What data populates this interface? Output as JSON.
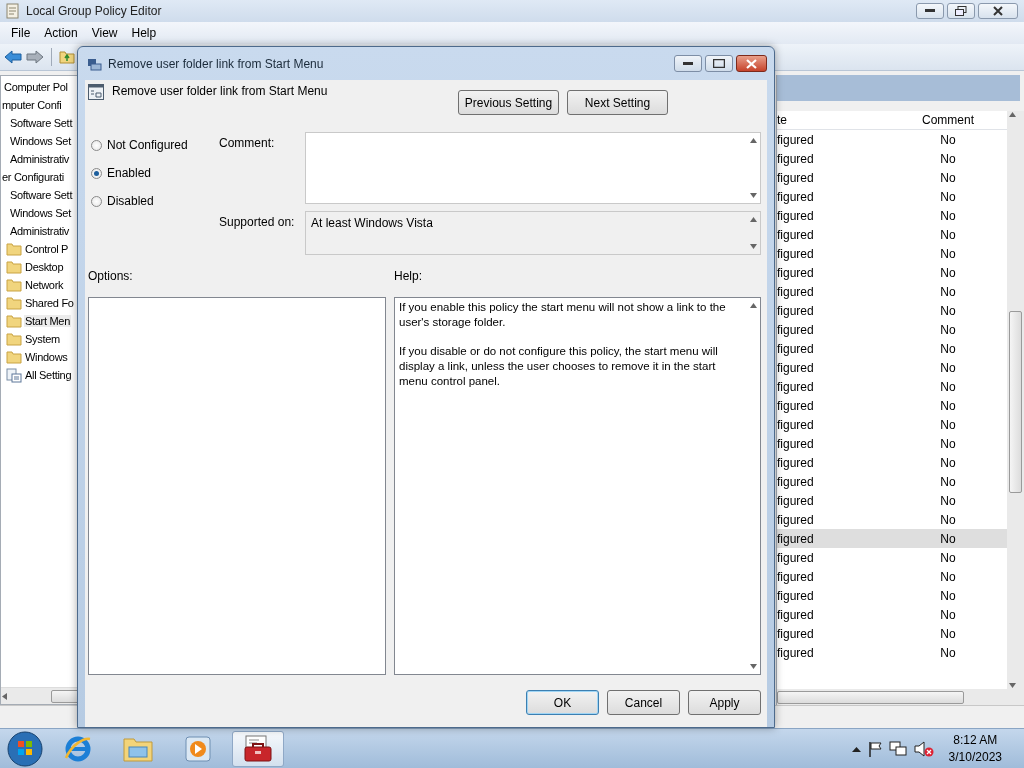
{
  "window": {
    "title": "Local Group Policy Editor"
  },
  "menu": [
    "File",
    "Action",
    "View",
    "Help"
  ],
  "tree": [
    {
      "label": "Computer Pol",
      "selected": false,
      "children": [
        {
          "label": "mputer Confi",
          "selected": false,
          "children": [
            {
              "label": "Software Sett",
              "selected": false
            },
            {
              "label": "Windows Set",
              "selected": false
            },
            {
              "label": "Administrativ",
              "selected": false
            }
          ]
        },
        {
          "label": "er Configurati",
          "selected": false,
          "children": [
            {
              "label": "Software Sett",
              "selected": false
            },
            {
              "label": "Windows Set",
              "selected": false
            },
            {
              "label": "Administrativ",
              "selected": false,
              "children": [
                {
                  "label": "Control P",
                  "selected": false,
                  "kind": "folder"
                },
                {
                  "label": "Desktop",
                  "selected": false,
                  "kind": "folder"
                },
                {
                  "label": "Network",
                  "selected": false,
                  "kind": "folder"
                },
                {
                  "label": "Shared Fo",
                  "selected": false,
                  "kind": "folder"
                },
                {
                  "label": "Start Men",
                  "selected": true,
                  "kind": "folder"
                },
                {
                  "label": "System",
                  "selected": false,
                  "kind": "folder"
                },
                {
                  "label": "Windows",
                  "selected": false,
                  "kind": "folder"
                },
                {
                  "label": "All Setting",
                  "selected": false,
                  "kind": "settings"
                }
              ]
            }
          ]
        }
      ]
    }
  ],
  "list": {
    "columns": [
      "te",
      "Comment"
    ],
    "rows": [
      {
        "state": "figured",
        "comment": "No",
        "selected": false
      },
      {
        "state": "figured",
        "comment": "No",
        "selected": false
      },
      {
        "state": "figured",
        "comment": "No",
        "selected": false
      },
      {
        "state": "figured",
        "comment": "No",
        "selected": false
      },
      {
        "state": "figured",
        "comment": "No",
        "selected": false
      },
      {
        "state": "figured",
        "comment": "No",
        "selected": false
      },
      {
        "state": "figured",
        "comment": "No",
        "selected": false
      },
      {
        "state": "figured",
        "comment": "No",
        "selected": false
      },
      {
        "state": "figured",
        "comment": "No",
        "selected": false
      },
      {
        "state": "figured",
        "comment": "No",
        "selected": false
      },
      {
        "state": "figured",
        "comment": "No",
        "selected": false
      },
      {
        "state": "figured",
        "comment": "No",
        "selected": false
      },
      {
        "state": "figured",
        "comment": "No",
        "selected": false
      },
      {
        "state": "figured",
        "comment": "No",
        "selected": false
      },
      {
        "state": "figured",
        "comment": "No",
        "selected": false
      },
      {
        "state": "figured",
        "comment": "No",
        "selected": false
      },
      {
        "state": "figured",
        "comment": "No",
        "selected": false
      },
      {
        "state": "figured",
        "comment": "No",
        "selected": false
      },
      {
        "state": "figured",
        "comment": "No",
        "selected": false
      },
      {
        "state": "figured",
        "comment": "No",
        "selected": false
      },
      {
        "state": "figured",
        "comment": "No",
        "selected": false
      },
      {
        "state": "figured",
        "comment": "No",
        "selected": true
      },
      {
        "state": "figured",
        "comment": "No",
        "selected": false
      },
      {
        "state": "figured",
        "comment": "No",
        "selected": false
      },
      {
        "state": "figured",
        "comment": "No",
        "selected": false
      },
      {
        "state": "figured",
        "comment": "No",
        "selected": false
      },
      {
        "state": "figured",
        "comment": "No",
        "selected": false
      },
      {
        "state": "figured",
        "comment": "No",
        "selected": false
      }
    ]
  },
  "dialog": {
    "title": "Remove user folder link from Start Menu",
    "heading": "Remove user folder link from Start Menu",
    "nav_buttons": [
      "Previous Setting",
      "Next Setting"
    ],
    "radios": [
      {
        "label": "Not Configured",
        "selected": false
      },
      {
        "label": "Enabled",
        "selected": true
      },
      {
        "label": "Disabled",
        "selected": false
      }
    ],
    "comment_label": "Comment:",
    "supported_label": "Supported on:",
    "supported_value": "At least Windows Vista",
    "options_label": "Options:",
    "help_label": "Help:",
    "help": [
      "If you enable this policy the start menu will not show a link to the user's storage folder.",
      "If you disable or do not configure this policy, the start menu will display a link, unless the user chooses to remove it in the start menu control panel."
    ],
    "buttons": [
      {
        "label": "OK",
        "focused": true
      },
      {
        "label": "Cancel",
        "focused": false
      },
      {
        "label": "Apply",
        "focused": false
      }
    ]
  },
  "taskbar": {
    "apps": [
      {
        "kind": "browser",
        "active": false
      },
      {
        "kind": "explorer",
        "active": false
      },
      {
        "kind": "media",
        "active": false
      },
      {
        "kind": "toolbox",
        "active": true
      }
    ],
    "time": "8:12 AM",
    "date": "3/10/2023"
  }
}
